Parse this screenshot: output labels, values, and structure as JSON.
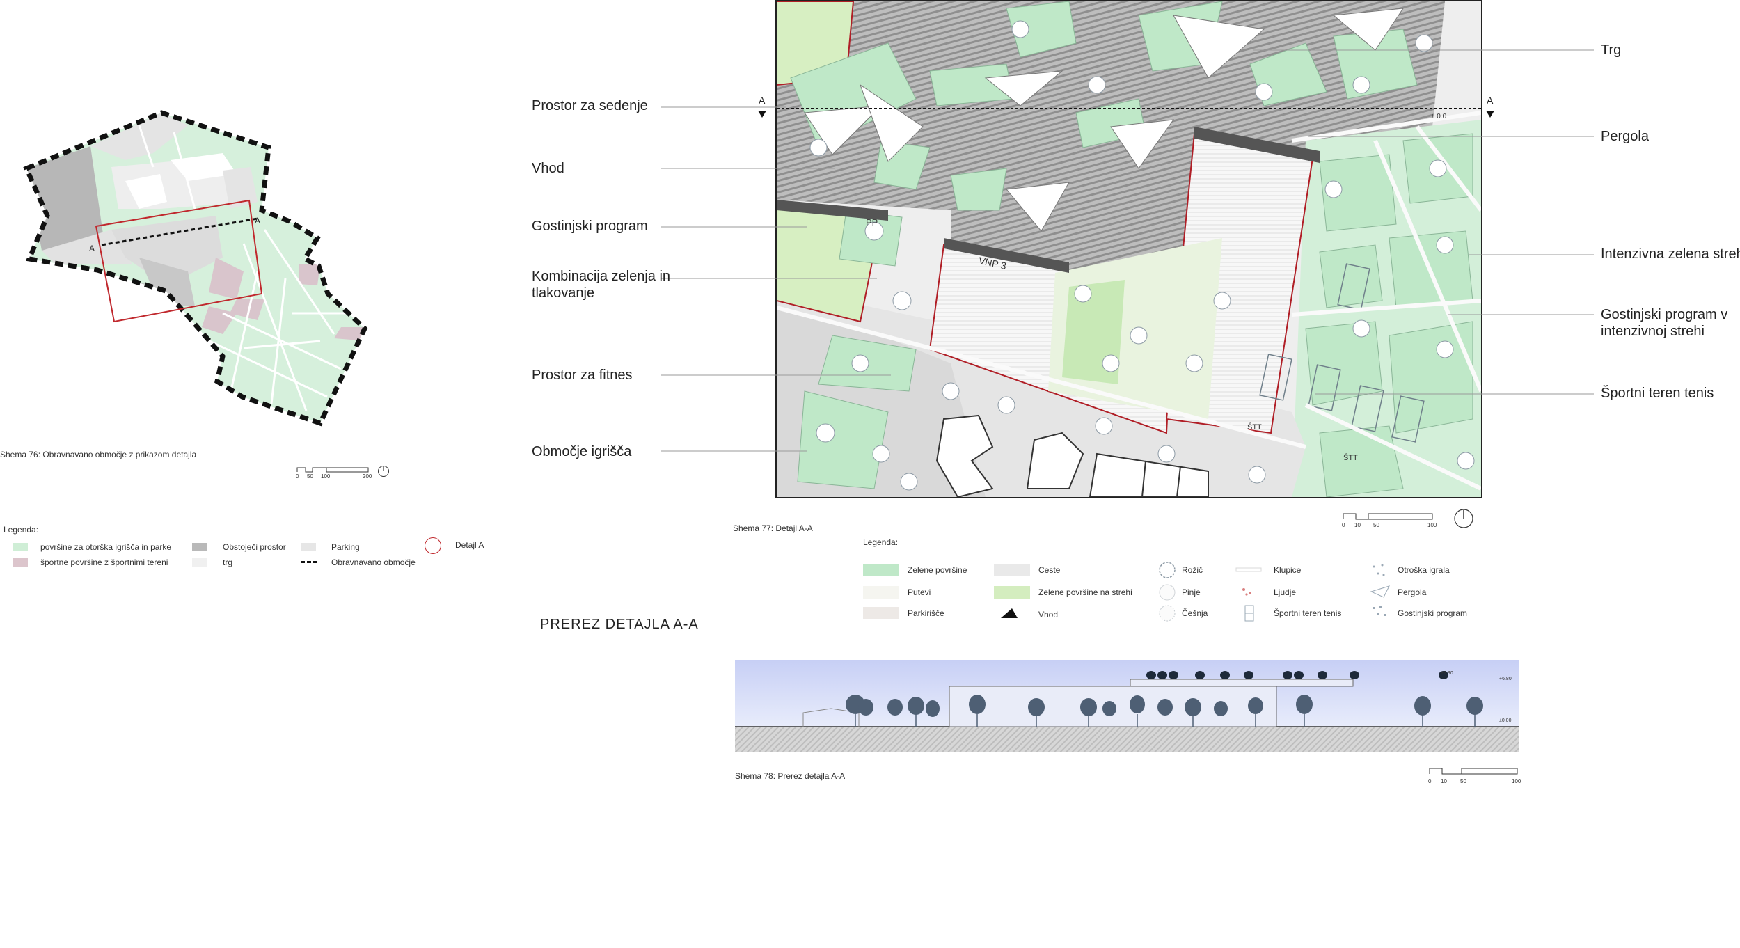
{
  "overview": {
    "caption": "Shema 76: Obravnavano območje z prikazom detajla",
    "section_mark_left": "A",
    "section_mark_right": "A",
    "scale_ticks": [
      "0",
      "50",
      "100",
      "200"
    ],
    "legend_title": "Legenda:",
    "legend": [
      {
        "label": "površine za otorška igrišča in parke",
        "color": "#cfeed6"
      },
      {
        "label": "športne površine z športnimi tereni",
        "color": "#dcc5cc"
      },
      {
        "label": "Obstoječi prostor",
        "color": "#b9b9b9"
      },
      {
        "label": "trg",
        "color": "#f0f0f0"
      },
      {
        "label": "Parking",
        "color": "#e6e6e6"
      },
      {
        "label": "Obravnavano območje",
        "color": "#111111"
      },
      {
        "label": "Detajl A",
        "color": "#c0282d"
      }
    ]
  },
  "detail": {
    "caption": "Shema 77: Detajl A-A",
    "section_mark": "A",
    "level_mark": "± 0.0",
    "plan_labels": {
      "pp": "PP",
      "vnp": "VNP 3",
      "stt1": "ŠTT",
      "stt2": "ŠTT"
    },
    "scale_ticks": [
      "0",
      "10",
      "50",
      "100"
    ],
    "callouts_left": [
      "Prostor za sedenje",
      "Vhod",
      "Gostinjski program",
      "Kombinacija zelenja in tlakovanje",
      "Prostor za fitnes",
      "Območje igrišča"
    ],
    "callouts_right": [
      "Trg",
      "Pergola",
      "Intenzivna zelena streha",
      "Gostinjski program v intenzivnoj strehi",
      "Športni teren tenis"
    ],
    "legend_title": "Legenda:",
    "legend": [
      {
        "label": "Zelene površine",
        "color": "#bfe8c8"
      },
      {
        "label": "Putevi",
        "color": "#f5f5f0"
      },
      {
        "label": "Parkirišče",
        "color": "#ede9e6"
      },
      {
        "label": "Ceste",
        "color": "#e9e9e9"
      },
      {
        "label": "Zelene površine na strehi",
        "color": "#d4edbf"
      },
      {
        "label": "Vhod",
        "color": "#111111"
      },
      {
        "label": "Rožič",
        "color": "#9aa8b5"
      },
      {
        "label": "Pinje",
        "color": "#c5cbd0"
      },
      {
        "label": "Češnja",
        "color": "#c5cbd0"
      },
      {
        "label": "Klupice",
        "color": "#d8d8d8"
      },
      {
        "label": "Ljudje",
        "color": "#d98080"
      },
      {
        "label": "Športni teren tenis",
        "color": "#9aa8b5"
      },
      {
        "label": "Otroška igrala",
        "color": "#9aa8b5"
      },
      {
        "label": "Pergola",
        "color": "#9aa8b5"
      },
      {
        "label": "Gostinjski program",
        "color": "#9aa8b5"
      }
    ]
  },
  "section": {
    "title": "PREREZ DETAJLA  A-A",
    "caption": "Shema 78: Prerez detajla A-A",
    "level_top": "+6.80",
    "level_mid": "+7.90",
    "level_ground": "±0.00",
    "scale_ticks": [
      "0",
      "10",
      "50",
      "100"
    ]
  }
}
